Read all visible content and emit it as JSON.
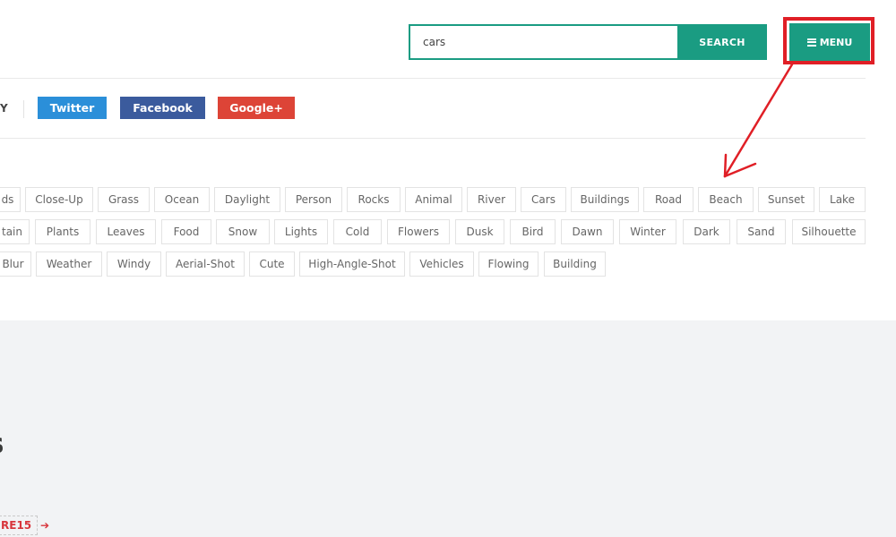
{
  "search": {
    "value": "cars",
    "button_label": "SEARCH"
  },
  "menu": {
    "label": "MENU",
    "icon": "hamburger-icon"
  },
  "share": {
    "cut_label": "Y",
    "buttons": [
      {
        "label": "Twitter",
        "color": "#2b8fd9"
      },
      {
        "label": "Facebook",
        "color": "#3b5b9d"
      },
      {
        "label": "Google+",
        "color": "#dd4437"
      }
    ]
  },
  "tags": {
    "row1": [
      "ds",
      "Close-Up",
      "Grass",
      "Ocean",
      "Daylight",
      "Person",
      "Rocks",
      "Animal",
      "River",
      "Cars",
      "Buildings",
      "Road",
      "Beach",
      "Sunset",
      "Lake"
    ],
    "row2": [
      "tain",
      "Plants",
      "Leaves",
      "Food",
      "Snow",
      "Lights",
      "Cold",
      "Flowers",
      "Dusk",
      "Bird",
      "Dawn",
      "Winter",
      "Dark",
      "Sand",
      "Silhouette"
    ],
    "row3": [
      "Blur",
      "Weather",
      "Windy",
      "Aerial-Shot",
      "Cute",
      "High-Angle-Shot",
      "Vehicles",
      "Flowing",
      "Building"
    ]
  },
  "section": {
    "heading": "s",
    "coupon": "RE15",
    "coupon_arrow": "➔"
  },
  "colors": {
    "accent": "#1a9c82",
    "highlight": "#e01f26",
    "section_bg": "#f2f3f5"
  }
}
